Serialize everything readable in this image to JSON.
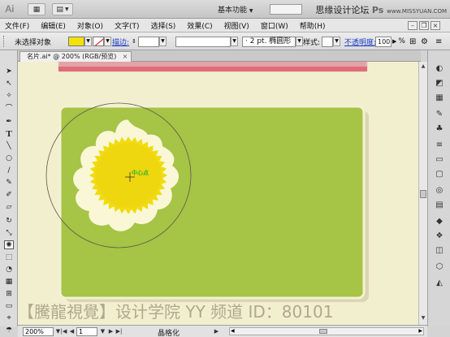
{
  "app": {
    "logo": "Ai",
    "workspace_label": "基本功能",
    "watermark_top": "思缘设计论坛",
    "watermark_top_site": "www.MISSYUAN.COM"
  },
  "menu": [
    "文件(F)",
    "编辑(E)",
    "对象(O)",
    "文字(T)",
    "选择(S)",
    "效果(C)",
    "视图(V)",
    "窗口(W)",
    "帮助(H)"
  ],
  "control_bar": {
    "selection_label": "未选择对象",
    "stroke_label": "描边:",
    "brush_label": "2 pt. 椭圆形",
    "style_label": "样式:",
    "opacity_label": "不透明度:",
    "opacity_value": "100",
    "opacity_unit": "%",
    "fill_color": "#f3e20a"
  },
  "document": {
    "tab_title": "名片.ai* @ 200% (RGB/预览)",
    "close_symbol": "×"
  },
  "canvas": {
    "center_label": "中心点",
    "card_color": "#a6c445",
    "sun_color": "#f0dc0f",
    "petal_color": "#faf7d6"
  },
  "status": {
    "zoom": "200%",
    "page": "1",
    "tool_name": "晶格化"
  },
  "bottom_watermark": "【騰龍視覺】设计学院  YY 频道 ID：80101"
}
